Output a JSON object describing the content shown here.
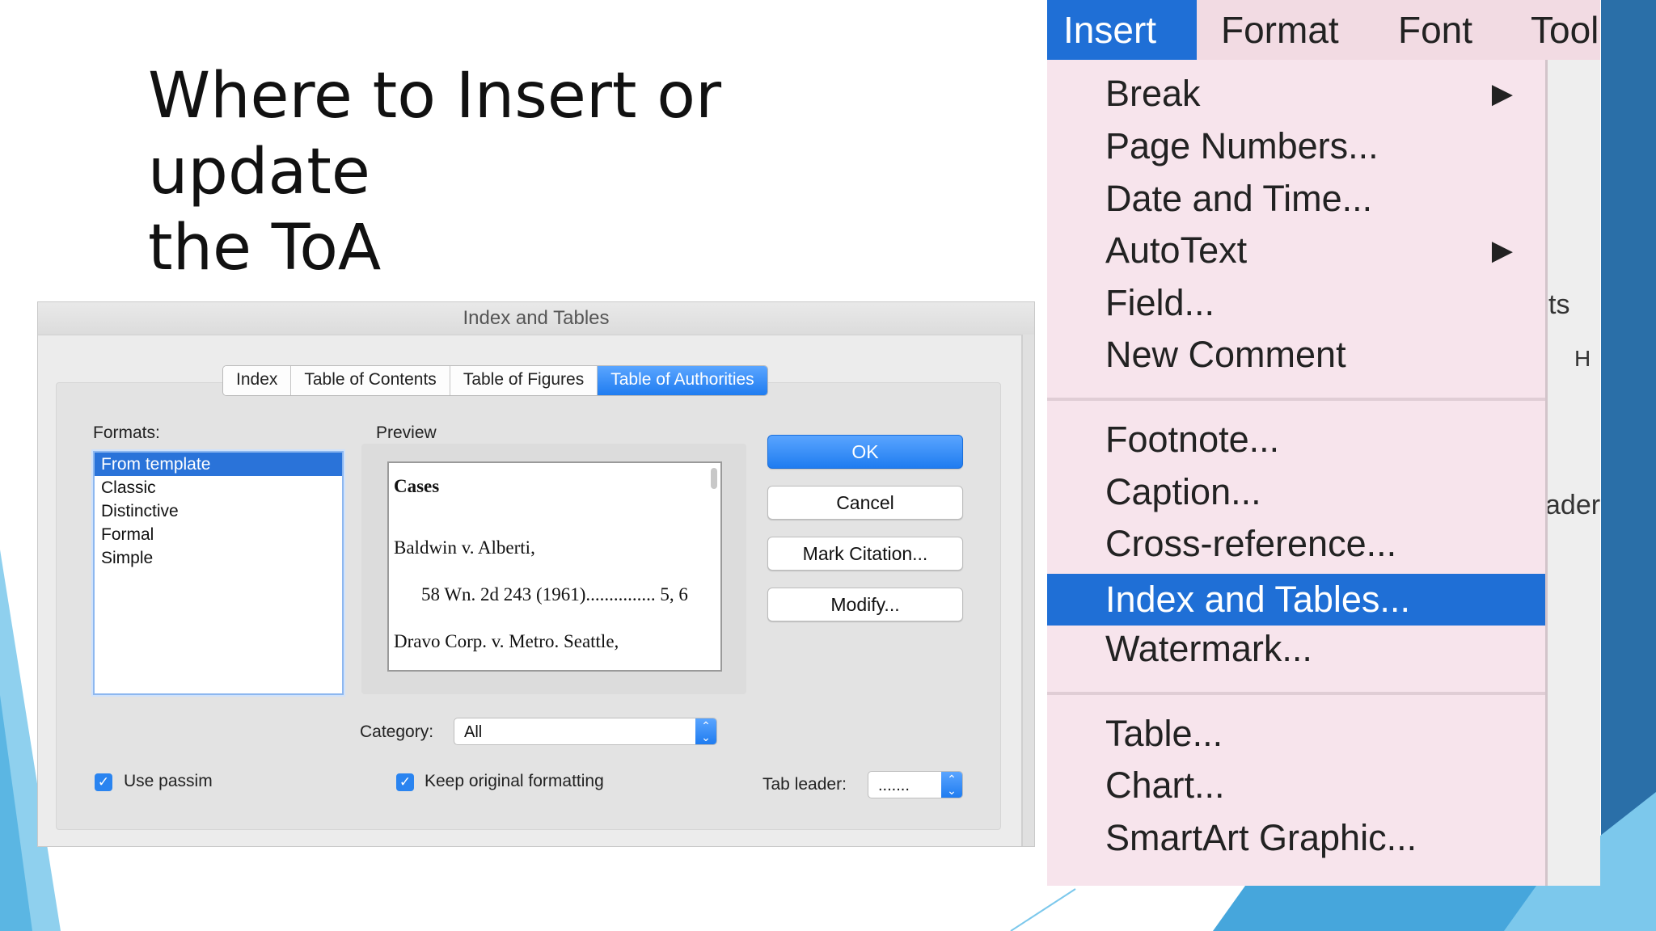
{
  "slide": {
    "title_line1": "Where to Insert or update",
    "title_line2": "the ToA"
  },
  "dialog": {
    "title": "Index and Tables",
    "tabs": [
      {
        "label": "Index",
        "active": false
      },
      {
        "label": "Table of Contents",
        "active": false
      },
      {
        "label": "Table of Figures",
        "active": false
      },
      {
        "label": "Table of Authorities",
        "active": true
      }
    ],
    "formats_label": "Formats:",
    "formats": [
      {
        "label": "From template",
        "selected": true
      },
      {
        "label": "Classic",
        "selected": false
      },
      {
        "label": "Distinctive",
        "selected": false
      },
      {
        "label": "Formal",
        "selected": false
      },
      {
        "label": "Simple",
        "selected": false
      }
    ],
    "preview_label": "Preview",
    "preview": {
      "heading": "Cases",
      "line1": "Baldwin v. Alberti,",
      "line2": "58 Wn. 2d 243 (1961)............... 5, 6",
      "line3": "Dravo Corp. v. Metro. Seattle,"
    },
    "buttons": {
      "ok": "OK",
      "cancel": "Cancel",
      "mark_citation": "Mark Citation...",
      "modify": "Modify..."
    },
    "category_label": "Category:",
    "category_value": "All",
    "use_passim_label": "Use passim",
    "keep_formatting_label": "Keep original formatting",
    "tab_leader_label": "Tab leader:",
    "tab_leader_value": "......."
  },
  "menu": {
    "menubar": [
      {
        "label": "Insert",
        "active": true
      },
      {
        "label": "Format",
        "active": false
      },
      {
        "label": "Font",
        "active": false
      },
      {
        "label": "Tool",
        "active": false
      }
    ],
    "group1": [
      {
        "label": "Break",
        "submenu": true
      },
      {
        "label": "Page Numbers...",
        "submenu": false
      },
      {
        "label": "Date and Time...",
        "submenu": false
      },
      {
        "label": "AutoText",
        "submenu": true
      },
      {
        "label": "Field...",
        "submenu": false
      },
      {
        "label": "New Comment",
        "submenu": false
      }
    ],
    "group2": [
      {
        "label": "Footnote...",
        "highlighted": false
      },
      {
        "label": "Caption...",
        "highlighted": false
      },
      {
        "label": "Cross-reference...",
        "highlighted": false
      },
      {
        "label": "Index and Tables...",
        "highlighted": true
      },
      {
        "label": "Watermark...",
        "highlighted": false
      }
    ],
    "group3": [
      {
        "label": "Table..."
      },
      {
        "label": "Chart..."
      },
      {
        "label": "SmartArt Graphic..."
      }
    ],
    "background_fragments": {
      "f1": "ts",
      "f2": "H",
      "f3": "ader"
    },
    "submenu_arrow": "▶"
  },
  "colors": {
    "accent_blue": "#1f6fd6",
    "menu_pink": "#f7e4ec",
    "slide_blue": "#2a6fa8"
  }
}
